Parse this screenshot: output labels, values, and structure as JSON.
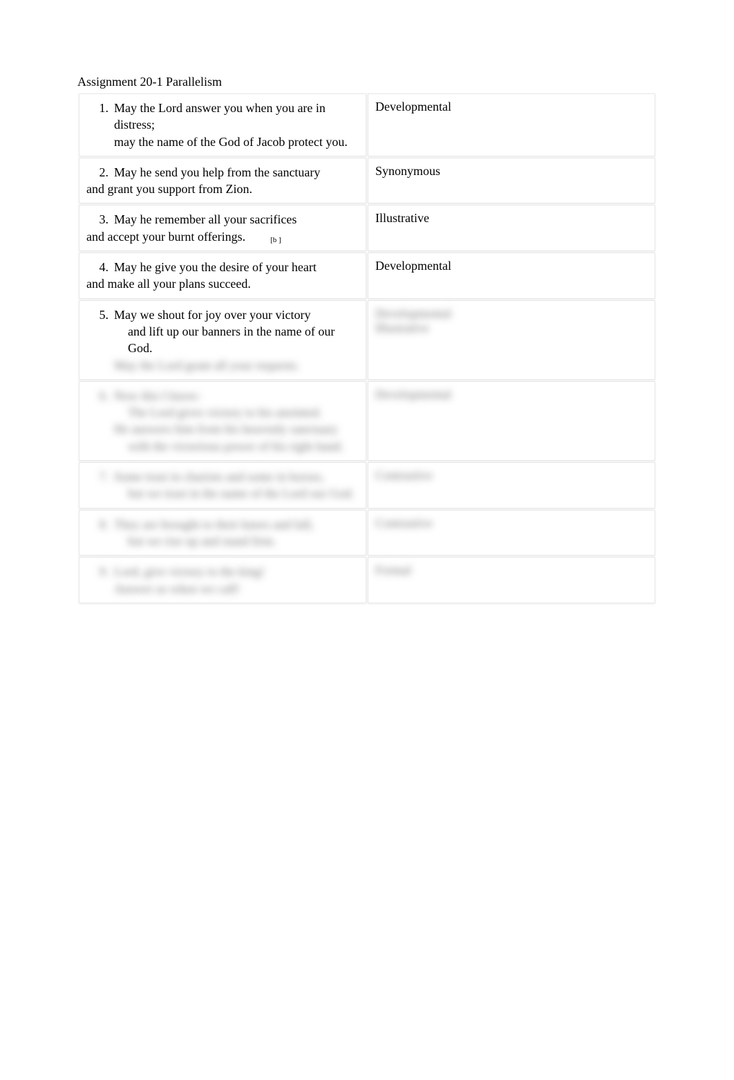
{
  "title": "Assignment 20-1 Parallelism",
  "rows": [
    {
      "num": "1.",
      "lines": [
        {
          "text": "May the Lord answer you when you are in distress;",
          "style": "normal"
        },
        {
          "text": "may the name of the God of Jacob protect you.",
          "style": "normal"
        }
      ],
      "type": "Developmental"
    },
    {
      "num": "2.",
      "lines": [
        {
          "text": "May he send you help from the sanctuary",
          "style": "normal"
        },
        {
          "text": "and grant you support from Zion.",
          "style": "flush"
        }
      ],
      "type": "Synonymous"
    },
    {
      "num": "3.",
      "lines": [
        {
          "text": "May he remember all your sacrifices",
          "style": "normal"
        },
        {
          "text": "and accept your burnt offerings.",
          "style": "flush",
          "footnote": "[b ]"
        }
      ],
      "type": "Illustrative"
    },
    {
      "num": "4.",
      "lines": [
        {
          "text": "May he give you the desire of your heart",
          "style": "normal"
        },
        {
          "text": "and make all your plans succeed.",
          "style": "flush"
        }
      ],
      "type": "Developmental"
    },
    {
      "num": "5.",
      "lines": [
        {
          "text": "May we shout for joy over your victory",
          "style": "normal"
        },
        {
          "text": "and lift up our banners in the name of our God.",
          "style": "indent"
        },
        {
          "text": "May the Lord grant all your requests.",
          "style": "normal",
          "blur": true
        }
      ],
      "type": "Developmental\nIllustrative",
      "typeBlur": true
    },
    {
      "num": "6.",
      "numBlur": true,
      "lines": [
        {
          "text": "Now this I know:",
          "style": "normal",
          "blur": true
        },
        {
          "text": "The Lord gives victory to his anointed.",
          "style": "indent",
          "blur": true
        },
        {
          "text": "He answers him from his heavenly sanctuary",
          "style": "normal",
          "blur": true
        },
        {
          "text": "with the victorious power of his right hand.",
          "style": "indent",
          "blur": true
        }
      ],
      "type": "Developmental",
      "typeBlur": true
    },
    {
      "num": "7.",
      "numBlur": true,
      "lines": [
        {
          "text": "Some trust in chariots and some in horses,",
          "style": "normal",
          "blur": true
        },
        {
          "text": "but we trust in the name of the Lord our God.",
          "style": "indent",
          "blur": true
        }
      ],
      "type": "Contrastive",
      "typeBlur": true
    },
    {
      "num": "8.",
      "numBlur": true,
      "lines": [
        {
          "text": "They are brought to their knees and fall,",
          "style": "normal",
          "blur": true
        },
        {
          "text": "but we rise up and stand firm.",
          "style": "indent",
          "blur": true
        }
      ],
      "type": "Contrastive",
      "typeBlur": true
    },
    {
      "num": "9.",
      "numBlur": true,
      "lines": [
        {
          "text": "Lord, give victory to the king!",
          "style": "normal",
          "blur": true
        },
        {
          "text": "Answer us when we call!",
          "style": "normal",
          "blur": true
        }
      ],
      "type": "Formal",
      "typeBlur": true
    }
  ]
}
